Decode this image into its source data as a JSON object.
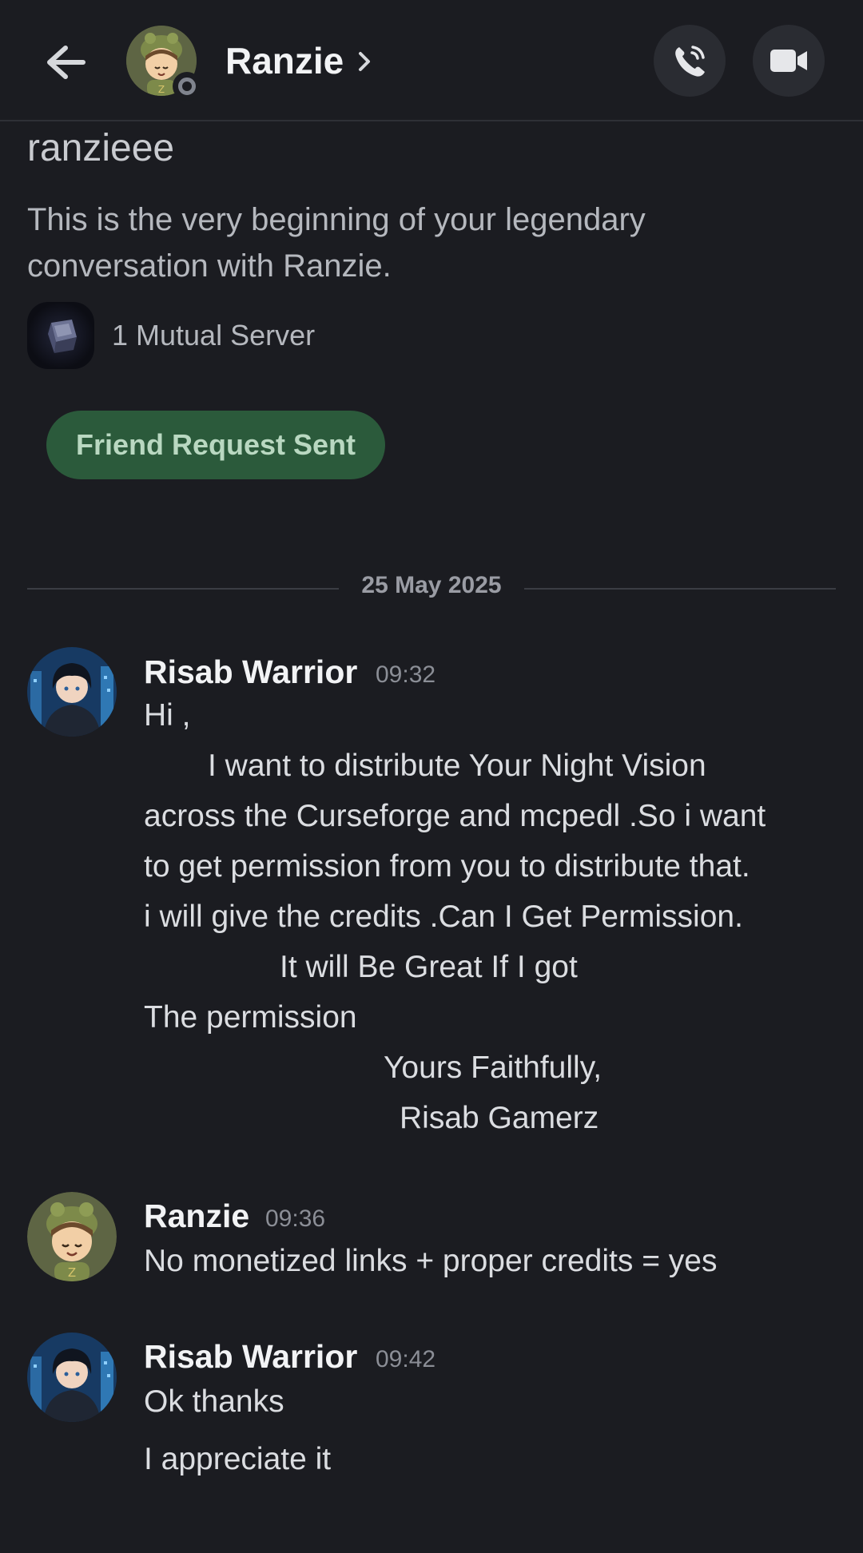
{
  "header": {
    "name": "Ranzie"
  },
  "intro": {
    "username": "ranzieee",
    "line1": "This is the very beginning of your legendary",
    "line2": "conversation with Ranzie.",
    "mutual_label": "1 Mutual Server",
    "friend_button": "Friend Request Sent"
  },
  "divider": {
    "date": "25 May 2025"
  },
  "messages": [
    {
      "author": "Risab Warrior",
      "time": "09:32",
      "lines": [
        "Hi ,",
        "I want to distribute Your Night Vision",
        "across the Curseforge and mcpedl .So i want",
        "to get permission from you to distribute that.",
        "i will give the credits .Can I Get Permission.",
        "It will Be Great If I got",
        "The permission",
        "Yours Faithfully,",
        "Risab Gamerz"
      ]
    },
    {
      "author": "Ranzie",
      "time": "09:36",
      "lines": [
        "No monetized links + proper credits = yes"
      ]
    },
    {
      "author": "Risab Warrior",
      "time": "09:42",
      "lines": [
        "Ok thanks",
        "I appreciate it"
      ]
    }
  ],
  "colors": {
    "background": "#1b1c21",
    "friend_button_bg": "#2b5a3b",
    "friend_button_text": "#b9d8c1",
    "status_offline": "#80848e"
  },
  "icons": {
    "back": "arrow-left-icon",
    "chevron": "chevron-right-icon",
    "call": "phone-call-icon",
    "video": "video-camera-icon",
    "status": "offline-status-icon"
  }
}
